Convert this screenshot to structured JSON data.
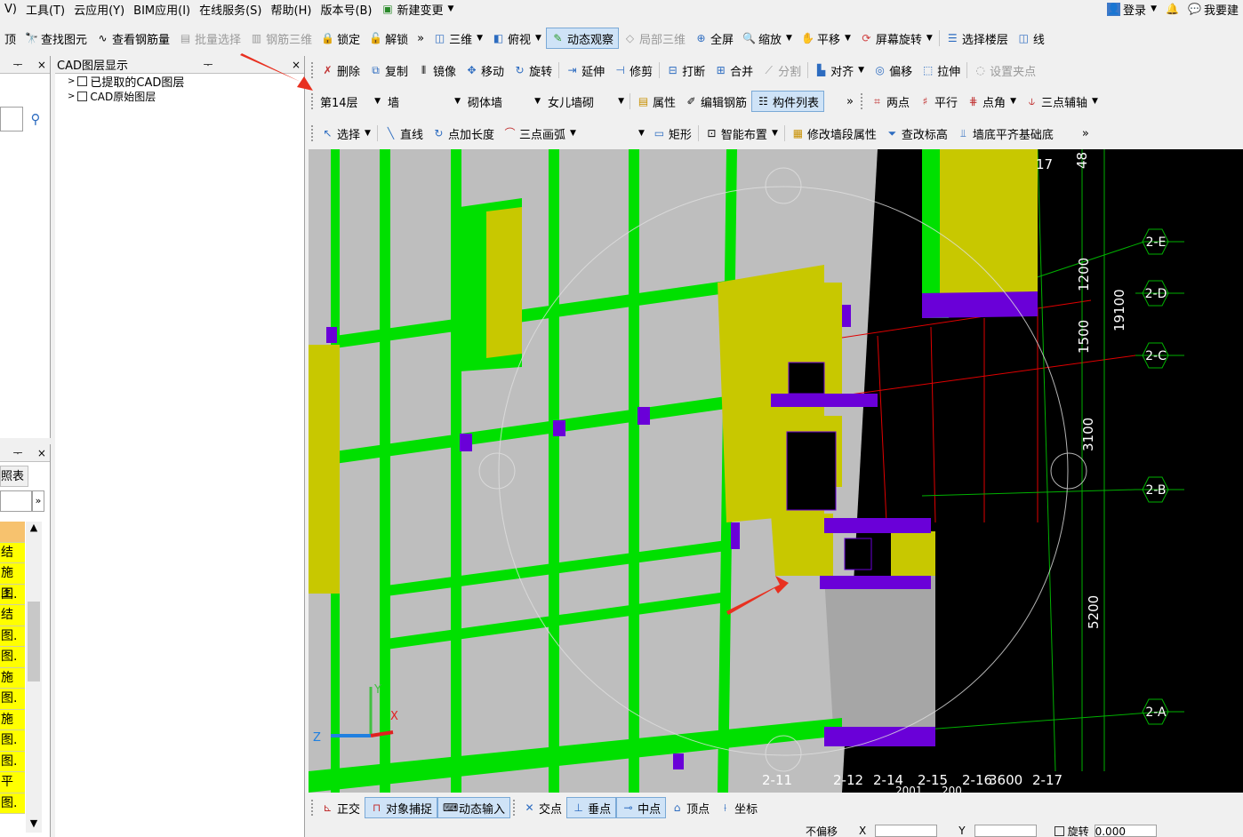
{
  "menu": [
    "V)",
    "工具(T)",
    "云应用(Y)",
    "BIM应用(I)",
    "在线服务(S)",
    "帮助(H)",
    "版本号(B)",
    "新建变更"
  ],
  "menu_right": {
    "login": "登录",
    "request": "我要建"
  },
  "toolbar1": {
    "items": [
      "顶",
      "查找图元",
      "查看钢筋量",
      "批量选择",
      "钢筋三维",
      "锁定",
      "解锁",
      "三维",
      "俯视",
      "动态观察",
      "局部三维",
      "全屏",
      "缩放",
      "平移",
      "屏幕旋转",
      "选择楼层",
      "线"
    ],
    "more": "»"
  },
  "toolbar2": {
    "items": [
      "删除",
      "复制",
      "镜像",
      "移动",
      "旋转",
      "延伸",
      "修剪",
      "打断",
      "合并",
      "分割",
      "对齐",
      "偏移",
      "拉伸",
      "设置夹点"
    ]
  },
  "toolbar3": {
    "floor": "第14层",
    "type": "墙",
    "subtype": "砌体墙",
    "component": "女儿墙砌",
    "items": [
      "属性",
      "编辑钢筋",
      "构件列表"
    ],
    "right": [
      "两点",
      "平行",
      "点角",
      "三点辅轴"
    ]
  },
  "toolbar4": {
    "items": [
      "选择",
      "直线",
      "点加长度",
      "三点画弧",
      "矩形",
      "智能布置",
      "修改墙段属性",
      "查改标高",
      "墙底平齐基础底"
    ]
  },
  "cad_panel": {
    "title": "CAD图层显示",
    "pin": "ᅮ",
    "close": "×",
    "layers": [
      "已提取的CAD图层",
      "CAD原始图层"
    ]
  },
  "left_panel": {
    "pin": "ᅮ",
    "close": "×",
    "header": "照表",
    "more": "»",
    "cells": [
      "结",
      "施工",
      "图.",
      "结",
      "图.",
      "图.",
      "施",
      "图.",
      "施",
      "图.",
      "图.",
      "平",
      "图."
    ]
  },
  "viewport": {
    "axis_labels": [
      "2-E",
      "2-D",
      "2-C",
      "2-B",
      "2-A"
    ],
    "dims": [
      "1200",
      "1500",
      "3100",
      "5200",
      "19100"
    ],
    "top_numbers": [
      "17",
      "48"
    ],
    "bottom_labels": [
      "2-11",
      "2-12",
      "2-14",
      "2-15",
      "2-16",
      "3600",
      "2-17",
      "2001",
      "200"
    ],
    "axis_letters": {
      "y": "Y",
      "x": "X",
      "z": "Z"
    }
  },
  "status_bar": {
    "items": [
      "正交",
      "对象捕捉",
      "动态输入",
      "交点",
      "垂点",
      "中点",
      "顶点",
      "坐标"
    ]
  },
  "bottom_row": {
    "offset": "不偏移",
    "x": "X",
    "y": "Y",
    "rotate": "旋转",
    "value": "0.000"
  },
  "colors": {
    "green": "#00e000",
    "yellow": "#c8c800",
    "purple": "#6a00d8",
    "gray": "#bebebe",
    "grid": "#00a000",
    "red": "#e00000"
  }
}
